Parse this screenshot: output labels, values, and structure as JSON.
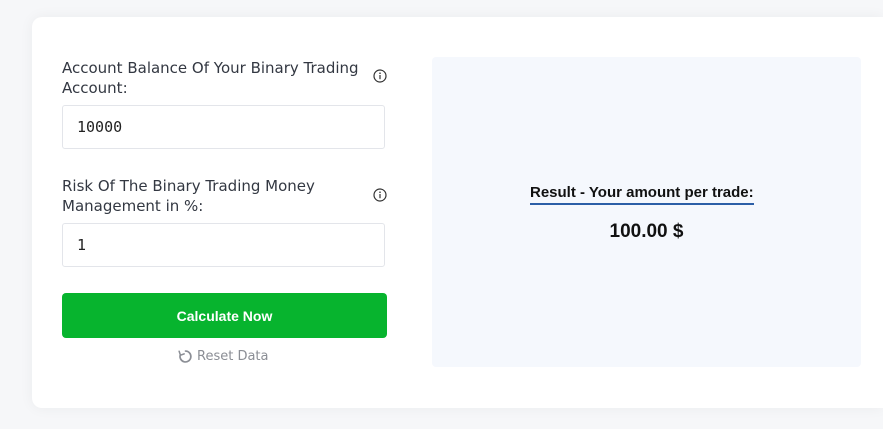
{
  "form": {
    "balance": {
      "label": "Account Balance Of Your Binary Trading Account:",
      "value": "10000",
      "info_icon": "info-circle-icon"
    },
    "risk": {
      "label": "Risk Of The Binary Trading Money Management in %:",
      "value": "1",
      "info_icon": "info-circle-icon"
    },
    "calculate_label": "Calculate Now",
    "reset_label": "Reset Data",
    "reset_icon": "refresh-icon"
  },
  "result": {
    "label": "Result - Your amount per trade:",
    "value": "100.00 $"
  },
  "colors": {
    "button_green": "#07b42e",
    "result_underline": "#2c5fa7",
    "result_background": "#f5f8fd"
  }
}
